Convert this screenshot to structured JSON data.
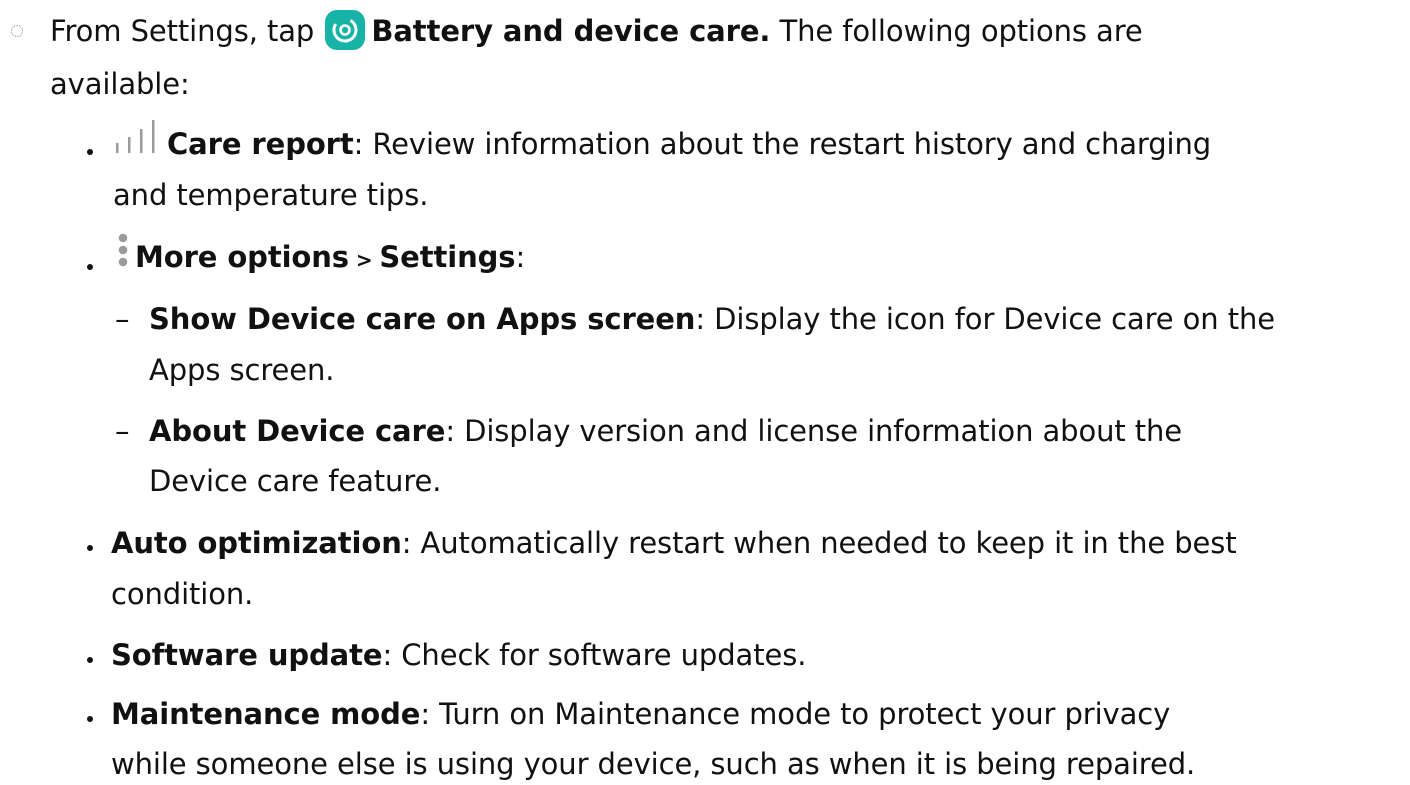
{
  "intro": {
    "part1": "From Settings, tap",
    "app_name": "Battery and device care.",
    "part2": "The following options are",
    "part3": "available:",
    "app_icon": "device-care-icon"
  },
  "items": [
    {
      "icon": "bar-chart-icon",
      "title": "Care report",
      "desc_line1": ": Review information about the restart history and charging",
      "desc_line2": "and temperature tips."
    },
    {
      "icon": "more-options-icon",
      "title": "More options",
      "separator": " > ",
      "title2": "Settings",
      "suffix": ":",
      "subitems": [
        {
          "title": "Show Device care on Apps screen",
          "desc_line1": ": Display the icon for Device care on the",
          "desc_line2": "Apps screen."
        },
        {
          "title": "About Device care",
          "desc_line1": ": Display version and license information about the",
          "desc_line2": "Device care feature."
        }
      ]
    },
    {
      "title": "Auto optimization",
      "desc_line1": ": Automatically restart when needed to keep it in the best",
      "desc_line2": "condition."
    },
    {
      "title": "Software update",
      "desc_line1": ": Check for software updates."
    },
    {
      "title": "Maintenance mode",
      "desc_line1": ": Turn on Maintenance mode to protect your privacy",
      "desc_line2": "while someone else is using your device, such as when it is being repaired."
    }
  ],
  "colors": {
    "text": "#111111",
    "app_icon_bg": "#17b3a6",
    "icon_gray": "#9a9a9a"
  }
}
